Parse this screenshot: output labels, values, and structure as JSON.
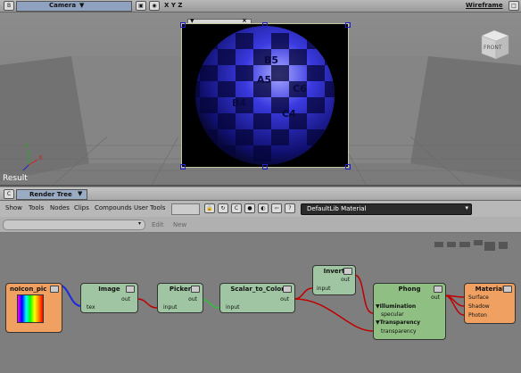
{
  "viewport": {
    "camera_label": "Camera",
    "axes_label": "X Y Z",
    "mode_label": "Wireframe",
    "result_label": "Result",
    "cube_label": "FRONT",
    "render_labels": [
      "B5",
      "C6",
      "C4",
      "B4",
      "A5"
    ],
    "axis_x": "X",
    "axis_y": "Y"
  },
  "render_tree": {
    "title": "Render Tree",
    "menu": [
      "Show",
      "Tools",
      "Nodes",
      "Clips",
      "Compounds",
      "User Tools"
    ],
    "library_select": "DefaultLib Material",
    "edit_label": "Edit",
    "new_label": "New",
    "help_icon_label": "?",
    "nodes": {
      "noicon": {
        "title": "noIcon_pic",
        "ports": [
          "tex"
        ]
      },
      "image": {
        "title": "Image",
        "ports": [
          "out",
          "tex"
        ]
      },
      "picker": {
        "title": "Picker",
        "ports": [
          "out",
          "input"
        ]
      },
      "scalar": {
        "title": "Scalar_to_Color",
        "ports": [
          "out",
          "input"
        ]
      },
      "invert": {
        "title": "Invert",
        "ports": [
          "out",
          "input"
        ]
      },
      "phong": {
        "title": "Phong",
        "ports": [
          "out",
          "Illumination",
          "specular",
          "Transparency",
          "transparency"
        ]
      },
      "material": {
        "title": "Material",
        "ports": [
          "Surface",
          "Shadow",
          "Photon"
        ]
      }
    }
  },
  "colors": {
    "node_green": "#9fc5a2",
    "node_orange": "#f0a060",
    "phong_green": "#8fbf82",
    "wire_red": "#c00000"
  }
}
